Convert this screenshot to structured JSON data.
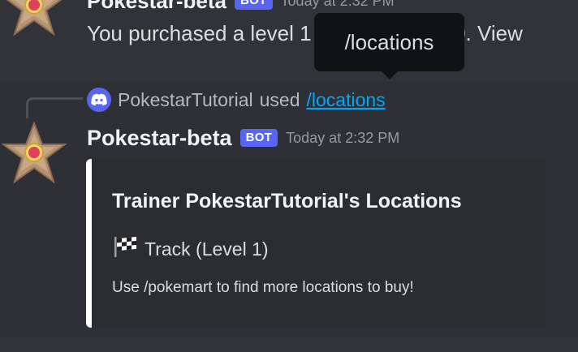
{
  "previous_message": {
    "author": "Pokestar-beta",
    "badge": "BOT",
    "timestamp": "Today at 2:32 PM",
    "text": "You purchased a level 1 Track for ₽1000. View"
  },
  "tooltip": {
    "text": "/locations"
  },
  "command_reply": {
    "user": "PokestarTutorial",
    "verb": "used",
    "command": "/locations"
  },
  "message": {
    "author": "Pokestar-beta",
    "badge": "BOT",
    "timestamp": "Today at 2:32 PM"
  },
  "embed": {
    "title": "Trainer PokestarTutorial's Locations",
    "location_icon": "checkered-flag-icon",
    "location_text": "Track (Level 1)",
    "footer_text": "Use /pokemart to find more locations to buy!",
    "accent_color": "#ffffff"
  },
  "colors": {
    "background": "#313338",
    "bot_badge": "#5865f2",
    "link": "#00a8fc",
    "embed_bg": "#2b2d31"
  }
}
